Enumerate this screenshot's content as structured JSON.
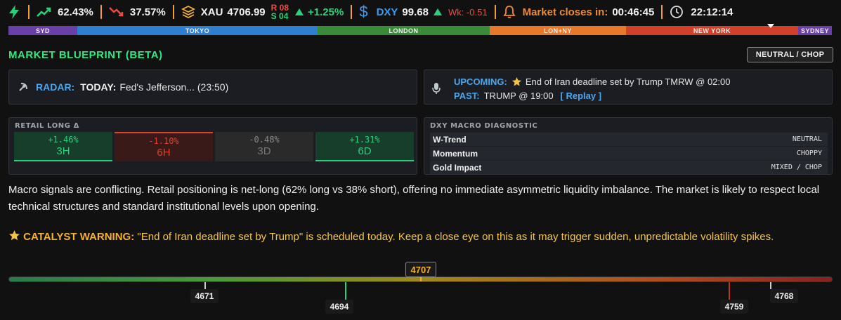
{
  "topbar": {
    "long_pct": "62.43%",
    "short_pct": "37.57%",
    "xau_label": "XAU",
    "xau_price": "4706.99",
    "r_label": "R",
    "r_value": "08",
    "s_label": "S",
    "s_value": "04",
    "xau_change": "+1.25%",
    "dxy_label": "DXY",
    "dxy_price": "99.68",
    "wk_change": "Wk: -0.51",
    "market_closes_label": "Market closes in:",
    "countdown": "00:46:45",
    "clock": "22:12:14",
    "icons": [
      "bolt-icon",
      "trend-up-icon",
      "trend-down-icon",
      "layers-icon",
      "triangle-up-icon",
      "dollar-icon",
      "bell-icon",
      "clock-icon"
    ]
  },
  "sessions": [
    {
      "label": "SYD",
      "color": "#6b3fa8"
    },
    {
      "label": "TOKYO",
      "color": "#2f7fd0"
    },
    {
      "label": "LONDON",
      "color": "#3a8a3a"
    },
    {
      "label": "LON+NY",
      "color": "#e8782a"
    },
    {
      "label": "NEW YORK",
      "color": "#d0402a"
    },
    {
      "label": "SYDNEY",
      "color": "#6b3fa8"
    }
  ],
  "header": {
    "title": "MARKET BLUEPRINT (BETA)",
    "status": "NEUTRAL / CHOP"
  },
  "radar": {
    "label": "RADAR:",
    "today_label": "TODAY:",
    "text": "Fed's Jefferson... (23:50)"
  },
  "schedule": {
    "upcoming_label": "UPCOMING:",
    "upcoming_text": "End of Iran deadline set by Trump TMRW @ 02:00",
    "past_label": "PAST:",
    "past_text": "TRUMP @ 19:00",
    "replay_label": "[ Replay ]"
  },
  "retail": {
    "title": "RETAIL LONG Δ",
    "cells": [
      {
        "pct": "+1.46%",
        "tf": "3H",
        "state": "up"
      },
      {
        "pct": "-1.10%",
        "tf": "6H",
        "state": "down"
      },
      {
        "pct": "-0.48%",
        "tf": "3D",
        "state": "neutral"
      },
      {
        "pct": "+1.31%",
        "tf": "6D",
        "state": "up"
      }
    ]
  },
  "dxy_diag": {
    "title": "DXY MACRO DIAGNOSTIC",
    "rows": [
      {
        "key": "W-Trend",
        "value": "NEUTRAL"
      },
      {
        "key": "Momentum",
        "value": "CHOPPY"
      },
      {
        "key": "Gold Impact",
        "value": "MIXED / CHOP"
      }
    ]
  },
  "analysis": "Macro signals are conflicting. Retail positioning is net-long (62% long vs 38% short), offering no immediate asymmetric liquidity imbalance. The market is likely to respect local technical structures and standard institutional levels upon opening.",
  "catalyst": {
    "label": "CATALYST WARNING:",
    "text": "\"End of Iran deadline set by Trump\" is scheduled today. Keep a close eye on this as it may trigger sudden, unpredictable volatility spikes."
  },
  "ladder": {
    "current_price": "4707",
    "levels": [
      {
        "value": "4671",
        "color": "#cccccc"
      },
      {
        "value": "4694",
        "color": "#2ad17a"
      },
      {
        "value": "4759",
        "color": "#c0302a"
      },
      {
        "value": "4768",
        "color": "#cccccc"
      }
    ]
  }
}
